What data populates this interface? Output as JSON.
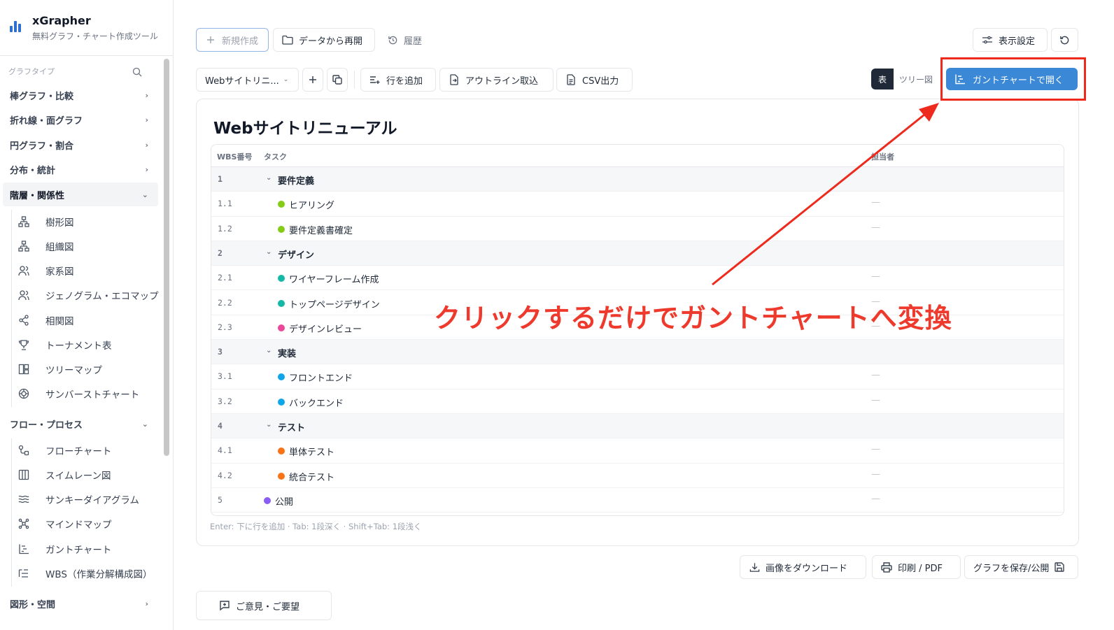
{
  "brand": {
    "title": "xGrapher",
    "subtitle": "無料グラフ・チャート作成ツール"
  },
  "sidebar": {
    "heading": "グラフタイプ",
    "categories": [
      {
        "label": "棒グラフ・比較"
      },
      {
        "label": "折れ線・面グラフ"
      },
      {
        "label": "円グラフ・割合"
      },
      {
        "label": "分布・統計"
      },
      {
        "label": "階層・関係性"
      },
      {
        "label": "フロー・プロセス"
      },
      {
        "label": "図形・空間"
      }
    ],
    "hierarchy_items": [
      {
        "label": "樹形図",
        "icon": "tree-icon"
      },
      {
        "label": "組織図",
        "icon": "org-icon"
      },
      {
        "label": "家系図",
        "icon": "people-icon"
      },
      {
        "label": "ジェノグラム・エコマップ",
        "icon": "people-icon"
      },
      {
        "label": "相関図",
        "icon": "share-icon"
      },
      {
        "label": "トーナメント表",
        "icon": "trophy-icon"
      },
      {
        "label": "ツリーマップ",
        "icon": "treemap-icon"
      },
      {
        "label": "サンバーストチャート",
        "icon": "sunburst-icon"
      }
    ],
    "flow_items": [
      {
        "label": "フローチャート",
        "icon": "flow-icon"
      },
      {
        "label": "スイムレーン図",
        "icon": "columns-icon"
      },
      {
        "label": "サンキーダイアグラム",
        "icon": "waves-icon"
      },
      {
        "label": "マインドマップ",
        "icon": "mindmap-icon"
      },
      {
        "label": "ガントチャート",
        "icon": "gantt-icon"
      },
      {
        "label": "WBS（作業分解構成図）",
        "icon": "list-tree-icon"
      }
    ]
  },
  "toolbar": {
    "new": "新規作成",
    "resume": "データから再開",
    "history": "履歴",
    "display_settings": "表示設定"
  },
  "edit_toolbar": {
    "project_select": "Webサイトリニ...",
    "add_row": "行を追加",
    "import_outline": "アウトライン取込",
    "csv_export": "CSV出力",
    "view_table": "表",
    "view_tree": "ツリー図",
    "open_gantt": "ガントチャートで開く"
  },
  "wbs": {
    "title": "Webサイトリニューアル",
    "columns": {
      "no": "WBS番号",
      "task": "タスク",
      "owner": "担当者"
    },
    "rows": [
      {
        "no": "1",
        "task": "要件定義",
        "group": true,
        "color": "",
        "owner": ""
      },
      {
        "no": "1.1",
        "task": "ヒアリング",
        "group": false,
        "color": "#84cc16",
        "owner": "—"
      },
      {
        "no": "1.2",
        "task": "要件定義書確定",
        "group": false,
        "color": "#84cc16",
        "owner": "—"
      },
      {
        "no": "2",
        "task": "デザイン",
        "group": true,
        "color": "",
        "owner": ""
      },
      {
        "no": "2.1",
        "task": "ワイヤーフレーム作成",
        "group": false,
        "color": "#14b8a6",
        "owner": "—"
      },
      {
        "no": "2.2",
        "task": "トップページデザイン",
        "group": false,
        "color": "#14b8a6",
        "owner": "—"
      },
      {
        "no": "2.3",
        "task": "デザインレビュー",
        "group": false,
        "color": "#ec4899",
        "owner": "—"
      },
      {
        "no": "3",
        "task": "実装",
        "group": true,
        "color": "",
        "owner": ""
      },
      {
        "no": "3.1",
        "task": "フロントエンド",
        "group": false,
        "color": "#0ea5e9",
        "owner": "—"
      },
      {
        "no": "3.2",
        "task": "バックエンド",
        "group": false,
        "color": "#0ea5e9",
        "owner": "—"
      },
      {
        "no": "4",
        "task": "テスト",
        "group": true,
        "color": "",
        "owner": ""
      },
      {
        "no": "4.1",
        "task": "単体テスト",
        "group": false,
        "color": "#f97316",
        "owner": "—"
      },
      {
        "no": "4.2",
        "task": "統合テスト",
        "group": false,
        "color": "#f97316",
        "owner": "—"
      },
      {
        "no": "5",
        "task": "公開",
        "group": false,
        "milestone": true,
        "color": "#8b5cf6",
        "owner": "—"
      }
    ],
    "hint": "Enter: 下に行を追加 · Tab: 1段深く · Shift+Tab: 1段浅く"
  },
  "bottom": {
    "download": "画像をダウンロード",
    "print": "印刷 / PDF",
    "save": "グラフを保存/公開",
    "feedback": "ご意見・ご要望"
  },
  "annotation": {
    "text": "クリックするだけでガントチャートへ変換",
    "color": "#ee3a2c"
  },
  "colors": {
    "accent": "#3a88d6",
    "annotation_red": "#ee2a1d",
    "brand": "#2f6fd0"
  }
}
